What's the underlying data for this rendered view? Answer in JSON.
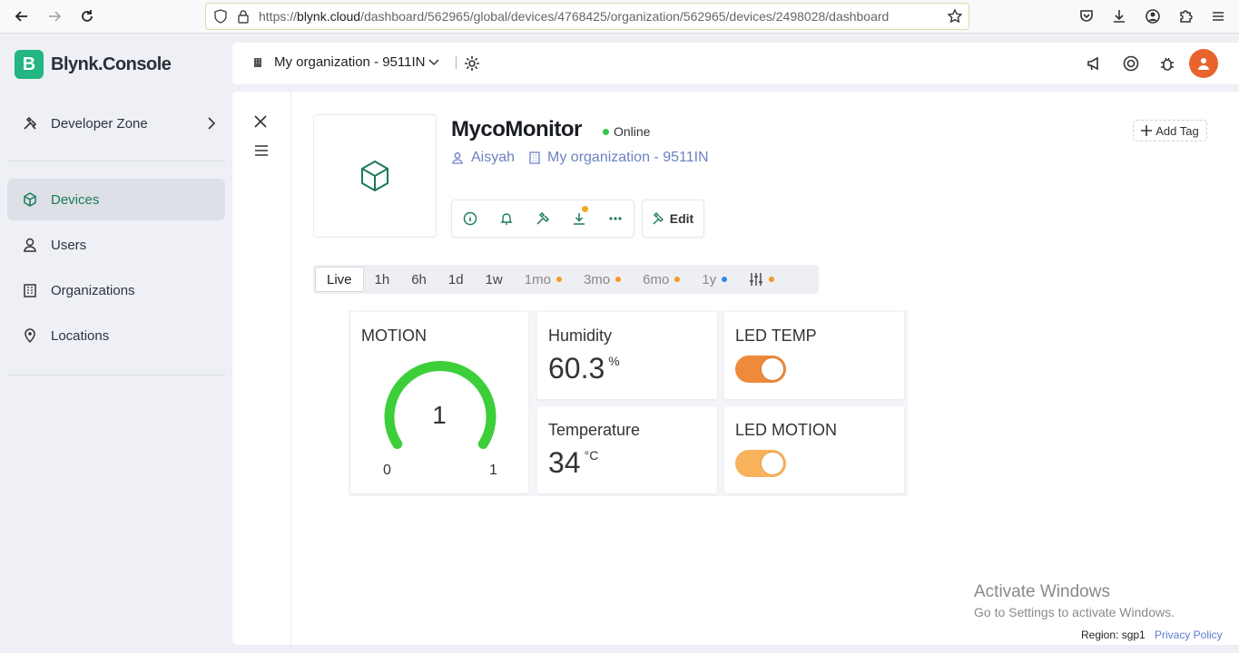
{
  "browser": {
    "url_prefix": "https://",
    "url_host": "blynk.cloud",
    "url_path": "/dashboard/562965/global/devices/4768425/organization/562965/devices/2498028/dashboard"
  },
  "sidebar": {
    "logo_letter": "B",
    "logo_text": "Blynk.Console",
    "items": [
      {
        "label": "Developer Zone",
        "icon": "hammer-wrench-icon"
      },
      {
        "label": "Devices",
        "icon": "cube-icon"
      },
      {
        "label": "Users",
        "icon": "user-icon"
      },
      {
        "label": "Organizations",
        "icon": "building-icon"
      },
      {
        "label": "Locations",
        "icon": "pin-icon"
      }
    ]
  },
  "header": {
    "org_name": "My organization - 9511IN",
    "separator": "|"
  },
  "device": {
    "name": "MycoMonitor",
    "status": "Online",
    "owner": "Aisyah",
    "organization": "My organization - 9511IN",
    "add_tag_label": "Add Tag",
    "edit_label": "Edit"
  },
  "time_ranges": [
    {
      "label": "Live",
      "dot": null
    },
    {
      "label": "1h",
      "dot": null
    },
    {
      "label": "6h",
      "dot": null
    },
    {
      "label": "1d",
      "dot": null
    },
    {
      "label": "1w",
      "dot": null
    },
    {
      "label": "1mo",
      "dot": "#f59a23"
    },
    {
      "label": "3mo",
      "dot": "#f59a23"
    },
    {
      "label": "6mo",
      "dot": "#f59a23"
    },
    {
      "label": "1y",
      "dot": "#2e8be8"
    }
  ],
  "widgets": {
    "motion": {
      "title": "MOTION",
      "value": "1",
      "min": "0",
      "max": "1",
      "level": 1.0,
      "color": "#3ccf3a"
    },
    "humidity": {
      "title": "Humidity",
      "value": "60.3",
      "unit": "%"
    },
    "temperature": {
      "title": "Temperature",
      "value": "34",
      "unit": "°C"
    },
    "led_temp": {
      "title": "LED TEMP",
      "on": true,
      "color": "#ee8a3a"
    },
    "led_motion": {
      "title": "LED MOTION",
      "on": true,
      "color": "#f8b25c"
    }
  },
  "windows_overlay": {
    "line1": "Activate Windows",
    "line2": "Go to Settings to activate Windows."
  },
  "footer": {
    "region": "Region: sgp1",
    "privacy": "Privacy Policy"
  },
  "colors": {
    "brand": "#23b582",
    "accent_link": "#6b82c4",
    "online": "#35c84a",
    "badge": "#f5a623"
  }
}
